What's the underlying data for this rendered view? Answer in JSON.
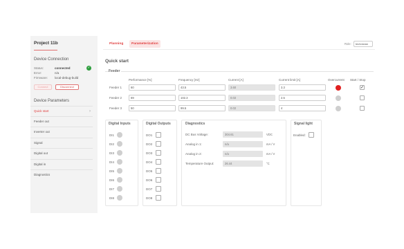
{
  "project": {
    "title": "Project 11b"
  },
  "device_connection": {
    "title": "Device Connection",
    "rows": [
      {
        "label": "Status:",
        "value": "connected"
      },
      {
        "label": "Error:",
        "value": "n/a"
      },
      {
        "label": "Firmware:",
        "value": "local-debug-build"
      }
    ],
    "connect_label": "Connect",
    "disconnect_label": "Disconnect",
    "status_icon": "check-circle-icon",
    "status_color": "#2e9e3e"
  },
  "device_parameters": {
    "title": "Device Parameters",
    "items": [
      {
        "label": "Quick start",
        "active": true
      },
      {
        "label": "Feeder out"
      },
      {
        "label": "Inverter out"
      },
      {
        "label": "Signal"
      },
      {
        "label": "Digital out"
      },
      {
        "label": "Digital in"
      },
      {
        "label": "Diagnostics"
      }
    ]
  },
  "tabs": [
    {
      "label": "Planning",
      "active": false
    },
    {
      "label": "Parameterization",
      "active": true
    }
  ],
  "role": {
    "label": "Role:",
    "value": "technician"
  },
  "page_title": "Quick start",
  "feeder": {
    "title": "Feeder",
    "columns": [
      "Performance [%]",
      "Frequency [Hz]",
      "Current [A]",
      "Current limit [A]",
      "Overcurrent",
      "Start / Stop"
    ],
    "rows": [
      {
        "label": "Feeder 1",
        "performance": "60",
        "frequency": "43.5",
        "current": "3.60",
        "limit": "3.3",
        "overcurrent": true,
        "running": true
      },
      {
        "label": "Feeder 2",
        "performance": "69",
        "frequency": "102.3",
        "current": "0.02",
        "limit": "2.5",
        "overcurrent": false,
        "running": false
      },
      {
        "label": "Feeder 3",
        "performance": "50",
        "frequency": "99.5",
        "current": "0.02",
        "limit": "4",
        "overcurrent": false,
        "running": false
      }
    ],
    "overcurrent_color": "#e02020"
  },
  "digital_inputs": {
    "title": "Digital Inputs",
    "labels": [
      "DI1",
      "DI2",
      "DI3",
      "DI4",
      "DI5",
      "DI6",
      "DI7",
      "DI8"
    ]
  },
  "digital_outputs": {
    "title": "Digital Outputs",
    "labels": [
      "DO1",
      "DO2",
      "DO3",
      "DO4",
      "DO5",
      "DO6",
      "DO7",
      "DO8"
    ]
  },
  "diagnostics": {
    "title": "Diagnostics",
    "rows": [
      {
        "label": "DC Bus Voltage:",
        "value": "304.61",
        "unit": "VDC"
      },
      {
        "label": "Analog in 1:",
        "value": "n/a",
        "unit": "mA / V"
      },
      {
        "label": "Analog in 2:",
        "value": "n/a",
        "unit": "mA / V"
      },
      {
        "label": "Temperature Output:",
        "value": "26.44",
        "unit": "°C"
      }
    ]
  },
  "signal_light": {
    "title": "Signal light",
    "enabled_label": "Enabled:"
  },
  "colors": {
    "accent": "#e04040",
    "sidebar_bg": "#f3f3f3"
  }
}
